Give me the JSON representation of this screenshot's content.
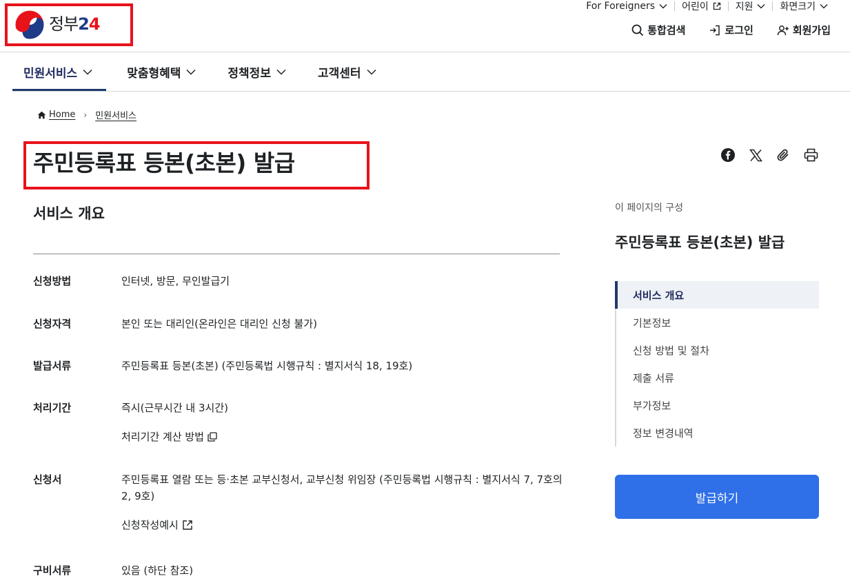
{
  "logo": {
    "text": "정부",
    "number": "2",
    "number4": "4"
  },
  "utility": {
    "foreigners": "For Foreigners",
    "kids": "어린이",
    "support": "지원",
    "screen_size": "화면크기"
  },
  "actions": {
    "search": "통합검색",
    "login": "로그인",
    "signup": "회원가입"
  },
  "gnb": {
    "items": [
      "민원서비스",
      "맞춤형혜택",
      "정책정보",
      "고객센터"
    ]
  },
  "breadcrumb": {
    "home": "Home",
    "current": "민원서비스"
  },
  "page_title": "주민등록표 등본(초본) 발급",
  "section_title": "서비스 개요",
  "info": {
    "method_k": "신청방법",
    "method_v": "인터넷, 방문, 무인발급기",
    "qual_k": "신청자격",
    "qual_v": "본인 또는 대리인(온라인은 대리인 신청 불가)",
    "docs_k": "발급서류",
    "docs_v": "주민등록표 등본(초본) (주민등록법 시행규칙 : 별지서식 18, 19호)",
    "period_k": "처리기간",
    "period_v": "즉시(근무시간 내 3시간)",
    "period_link": "처리기간 계산 방법",
    "form_k": "신청서",
    "form_v": "주민등록표 열람 또는 등·초본 교부신청서, 교부신청 위임장 (주민등록법 시행규칙 : 별지서식 7, 7호의2, 9호)",
    "form_link": "신청작성예시",
    "req_k": "구비서류",
    "req_v": "있음 (하단 참조)"
  },
  "toc": {
    "label": "이 페이지의 구성",
    "title": "주민등록표 등본(초본) 발급",
    "items": [
      "서비스 개요",
      "기본정보",
      "신청 방법 및 절차",
      "제출 서류",
      "부가정보",
      "정보 변경내역"
    ]
  },
  "apply_button": "발급하기",
  "colors": {
    "accent": "#2f6fe8",
    "highlight": "#e8121b",
    "nav_active": "#1e3a6e"
  }
}
